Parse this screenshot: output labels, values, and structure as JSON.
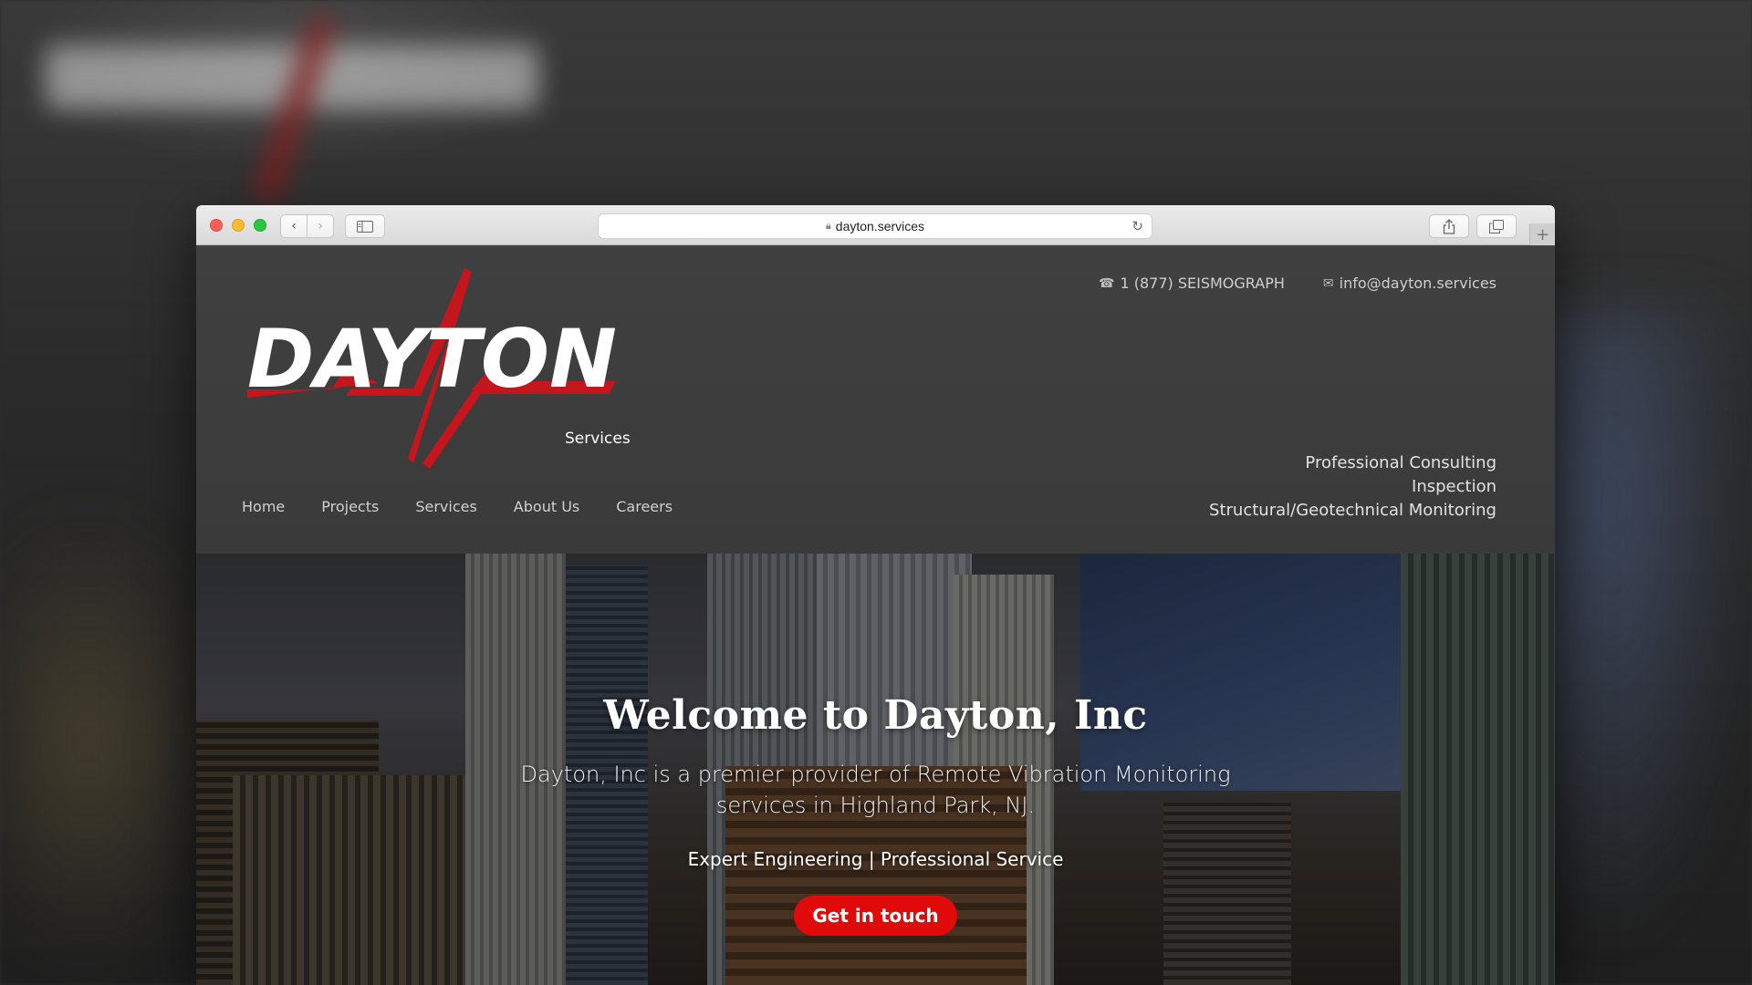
{
  "browser": {
    "url": "dayton.services"
  },
  "header": {
    "logo_text": "DAYTON",
    "logo_sub": "Services",
    "phone": "1 (877) SEISMOGRAPH",
    "email": "info@dayton.services",
    "nav": [
      "Home",
      "Projects",
      "Services",
      "About Us",
      "Careers"
    ],
    "taglines": [
      "Professional Consulting",
      "Inspection",
      "Structural/Geotechnical Monitoring"
    ]
  },
  "hero": {
    "title": "Welcome to Dayton, Inc",
    "description": "Dayton, Inc is a premier provider of Remote Vibration Monitoring services in Highland Park, NJ.",
    "subtitle": "Expert Engineering | Professional Service",
    "cta": "Get in touch"
  },
  "colors": {
    "brand_red": "#e00a0a",
    "header_bg": "#404040"
  }
}
